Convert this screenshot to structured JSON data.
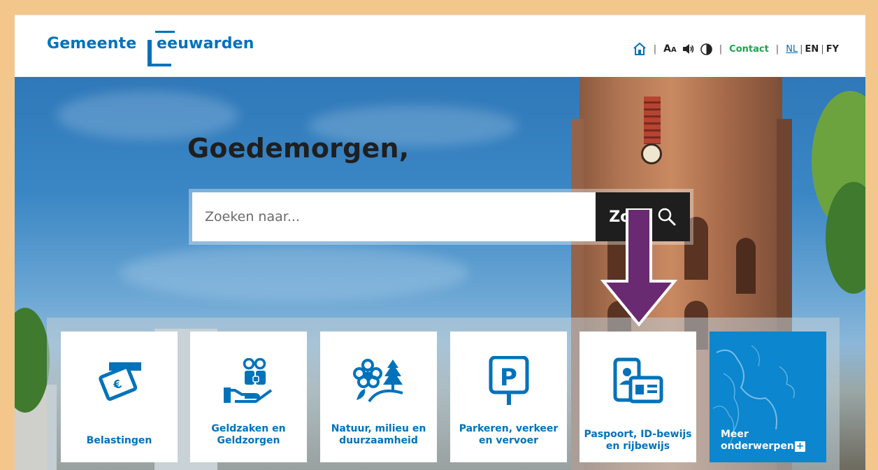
{
  "header": {
    "logo_left": "Gemeente",
    "logo_right": "eeuwarden",
    "utility": {
      "home_icon": "home-icon",
      "text_size": "AA",
      "speaker_icon": "speaker-icon",
      "contrast_icon": "contrast-icon",
      "contact": "Contact",
      "lang_nl": "NL",
      "lang_en": "EN",
      "lang_fy": "FY"
    }
  },
  "hero": {
    "greeting": "Goedemorgen,",
    "search": {
      "placeholder": "Zoeken naar...",
      "button_label": "Zoek",
      "button_icon": "search-icon"
    }
  },
  "tiles": [
    {
      "label": "Belastingen",
      "icon": "tax-card-icon"
    },
    {
      "label": "Geldzaken en Geldzorgen",
      "icon": "money-care-icon"
    },
    {
      "label": "Natuur, milieu en duurzaamheid",
      "icon": "nature-icon"
    },
    {
      "label": "Parkeren, verkeer en vervoer",
      "icon": "parking-icon"
    },
    {
      "label": "Paspoort, ID-bewijs en rijbewijs",
      "icon": "id-card-icon"
    },
    {
      "label": "Meer onderwerpen",
      "icon": "plus-icon"
    }
  ],
  "colors": {
    "brand_blue": "#0072bb",
    "contact_green": "#1aa34a",
    "search_button": "#1e1e1e",
    "more_tile": "#0b86cf",
    "arrow_purple": "#6a2a72",
    "page_border": "#f3c68b"
  }
}
